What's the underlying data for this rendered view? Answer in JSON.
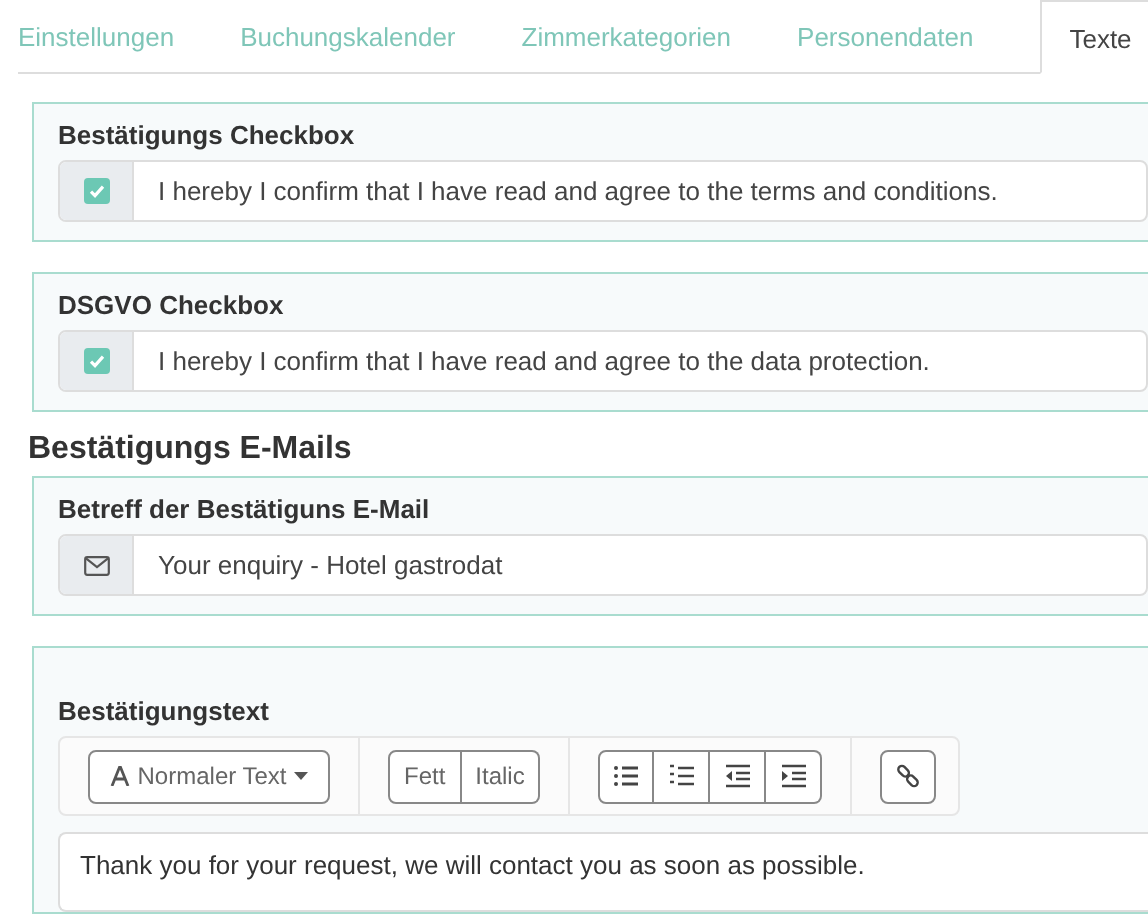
{
  "tabs": [
    {
      "label": "Einstellungen",
      "selected": false
    },
    {
      "label": "Buchungskalender",
      "selected": false
    },
    {
      "label": "Zimmerkategorien",
      "selected": false
    },
    {
      "label": "Personendaten",
      "selected": false
    },
    {
      "label": "Texte",
      "selected": true
    }
  ],
  "checkbox_panels": [
    {
      "title": "Bestätigungs Checkbox",
      "checked": true,
      "text": "I hereby I confirm that I have read and agree to the terms and conditions."
    },
    {
      "title": "DSGVO Checkbox",
      "checked": true,
      "text": "I hereby I confirm that I have read and agree to the data protection."
    }
  ],
  "section_heading": "Bestätigungs E-Mails",
  "subject": {
    "title": "Betreff der Bestätiguns E-Mail",
    "value": "Your enquiry - Hotel gastrodat"
  },
  "editor": {
    "title": "Bestätigungstext",
    "style_dropdown": "Normaler Text",
    "format_buttons": [
      "Fett",
      "Italic"
    ],
    "text": "Thank you for your request, we will contact you as soon as possible."
  }
}
